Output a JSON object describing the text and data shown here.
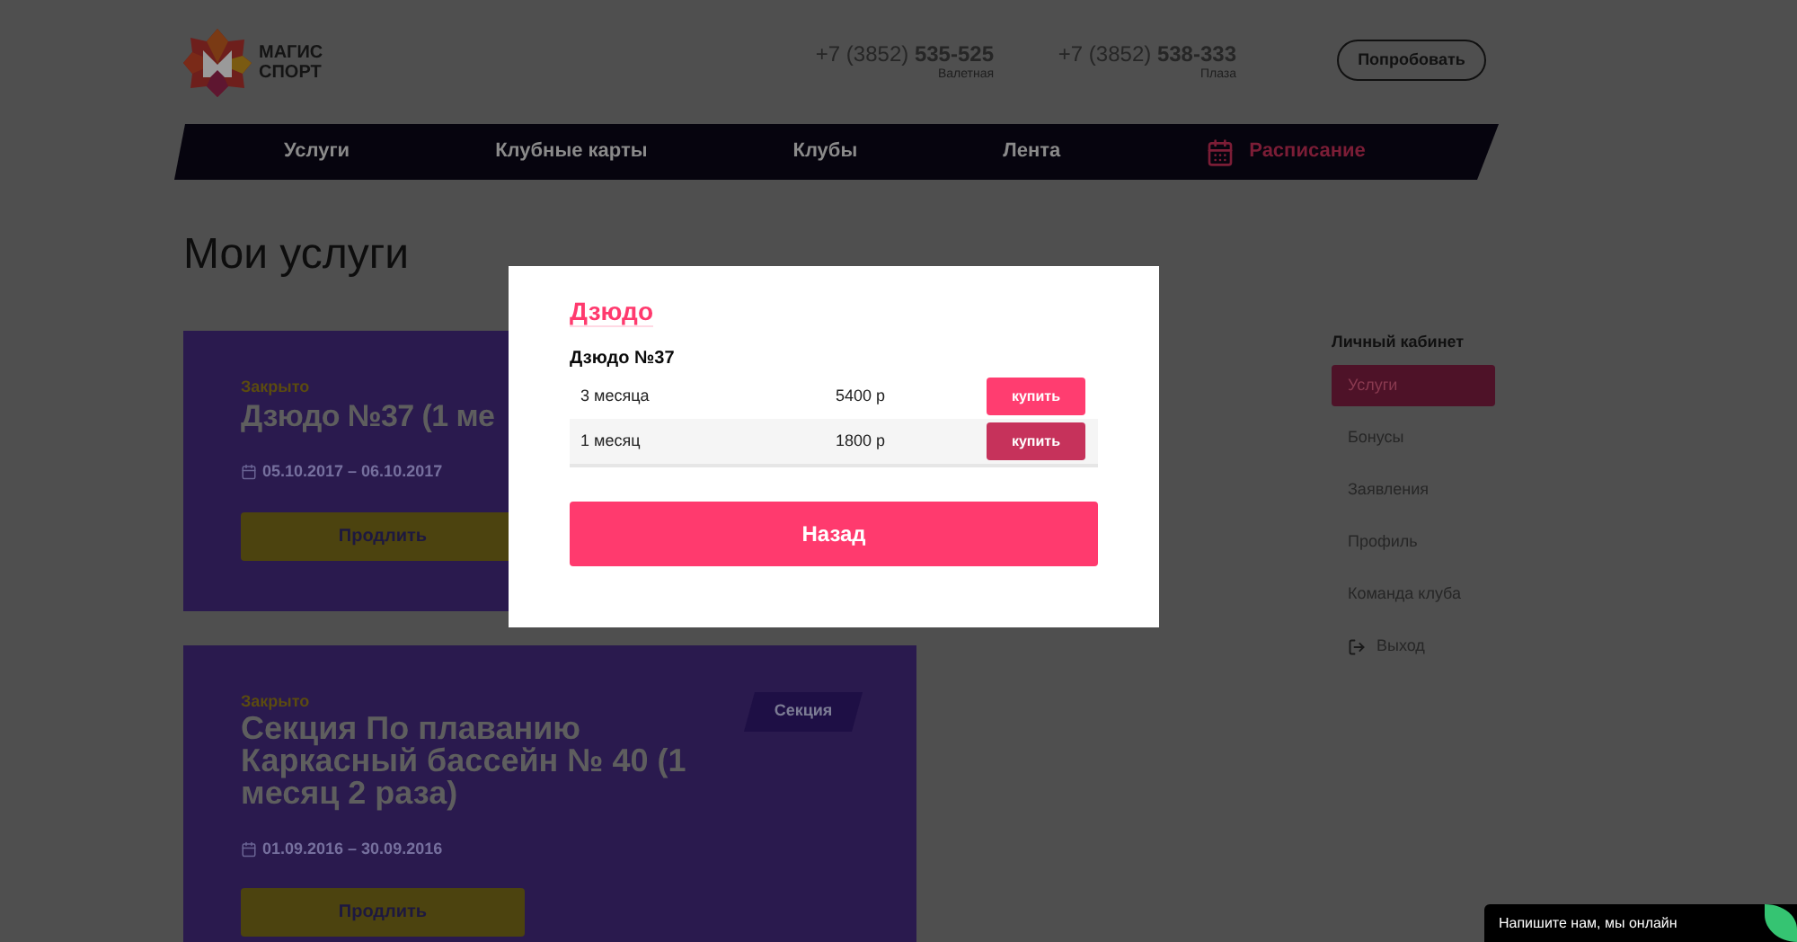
{
  "header": {
    "logo": {
      "lines": [
        "МАГИС",
        "СПОРТ"
      ]
    },
    "phones": [
      {
        "number": "+7 (3852) **535-525**",
        "label": "Валетная"
      },
      {
        "number": "+7 (3852) **538-333**",
        "label": "Плаза"
      }
    ],
    "try_button": "Попробовать"
  },
  "nav": {
    "items": [
      {
        "label": "Услуги",
        "accent": false
      },
      {
        "label": "Клубные карты",
        "accent": false
      },
      {
        "label": "Клубы",
        "accent": false
      },
      {
        "label": "Лента",
        "accent": false
      },
      {
        "label": "Расписание",
        "accent": true
      }
    ]
  },
  "page_title": "Мои услуги",
  "services": [
    {
      "status": "Закрыто",
      "title": "Дзюдо №37 (1 ме",
      "dates": "05.10.2017 – 06.10.2017",
      "button": "Продлить"
    },
    {
      "status": "Закрыто",
      "badge": "Секция",
      "title": "Секция По плаванию Каркасный бассейн № 40 (1 месяц 2 раза)",
      "dates": "01.09.2016 – 30.09.2016",
      "button": "Продлить"
    }
  ],
  "sidebar": {
    "heading": "Личный кабинет",
    "items": [
      {
        "label": "Услуги",
        "selected": true,
        "kind": "link"
      },
      {
        "label": "Бонусы",
        "selected": false,
        "kind": "link"
      },
      {
        "label": "Заявления",
        "selected": false,
        "kind": "link"
      },
      {
        "label": "Профиль",
        "selected": false,
        "kind": "link"
      },
      {
        "label": "Команда клуба",
        "selected": false,
        "kind": "link"
      },
      {
        "label": "Выход",
        "selected": false,
        "kind": "logout"
      }
    ]
  },
  "modal": {
    "title": "Дзюдо",
    "subtitle": "Дзюдо №37",
    "rows": [
      {
        "period": "3 месяца",
        "price": "5400 р",
        "button": "купить",
        "hovered": false
      },
      {
        "period": "1 месяц",
        "price": "1800 р",
        "button": "купить",
        "hovered": true
      }
    ],
    "back_button": "Назад"
  },
  "chat": {
    "text": "Напишите нам, мы онлайн"
  }
}
